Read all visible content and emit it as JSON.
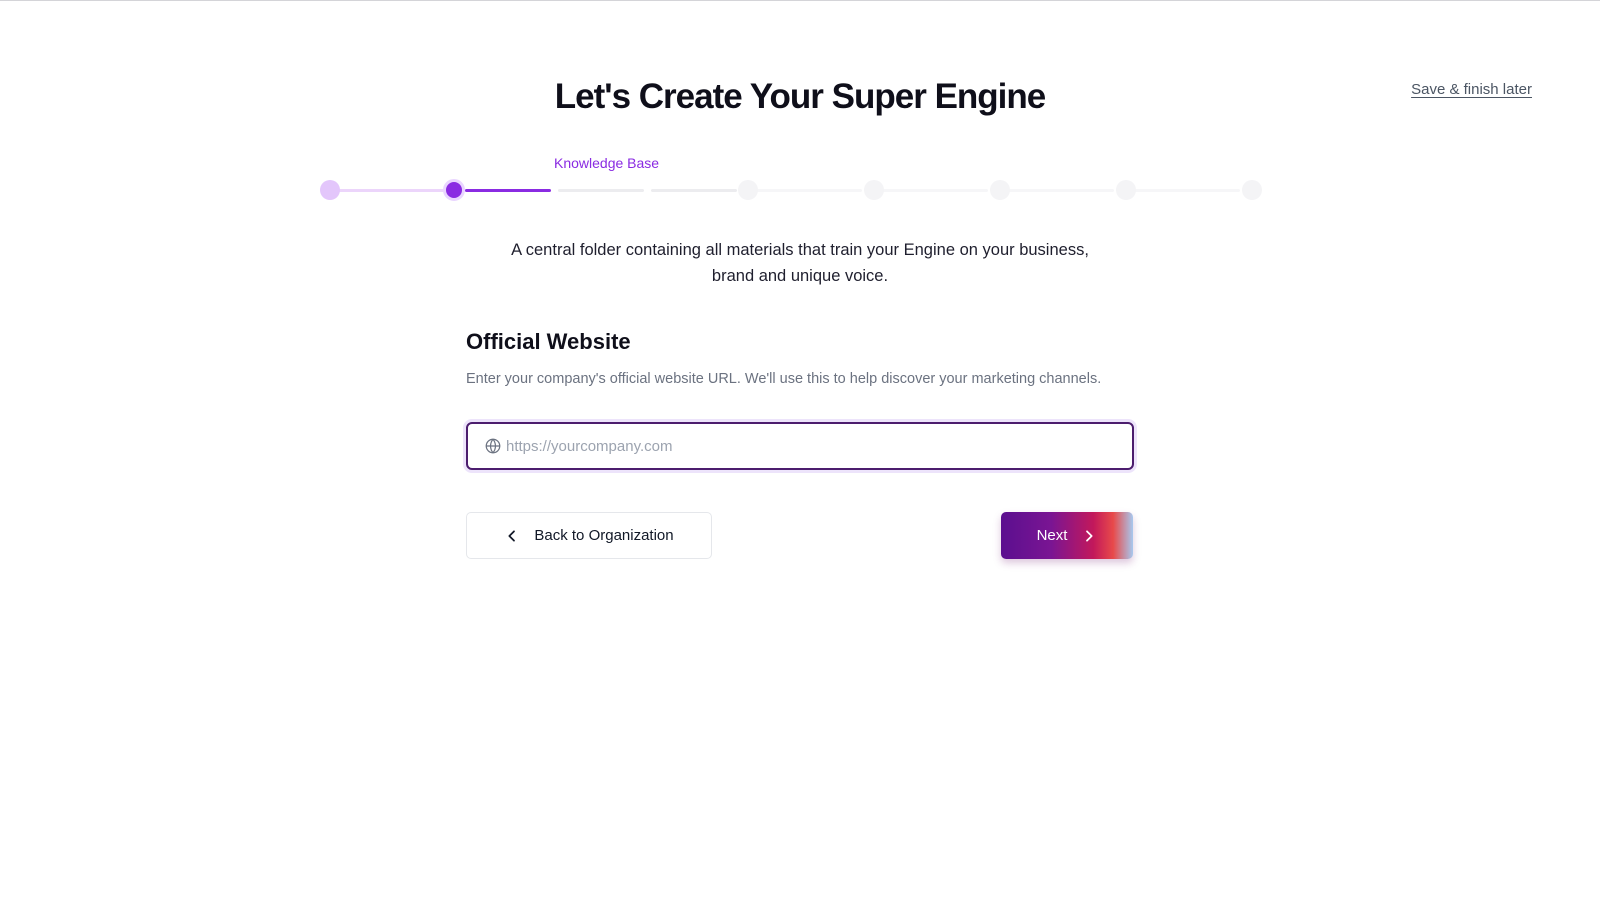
{
  "header": {
    "title": "Let's Create Your Super Engine",
    "save_later": "Save & finish later"
  },
  "stepper": {
    "current_label": "Knowledge Base",
    "total_steps": 8,
    "current_step": 2,
    "accent_color": "#8a2be2"
  },
  "description": "A central folder containing all materials that train your Engine on your business, brand and unique voice.",
  "section": {
    "title": "Official Website",
    "help": "Enter your company's official website URL. We'll use this to help discover your marketing channels."
  },
  "website_input": {
    "value": "",
    "placeholder": "https://yourcompany.com",
    "icon": "globe-icon"
  },
  "actions": {
    "back_label": "Back to Organization",
    "back_icon": "chevron-left-icon",
    "next_label": "Next",
    "next_icon": "chevron-right-icon"
  }
}
